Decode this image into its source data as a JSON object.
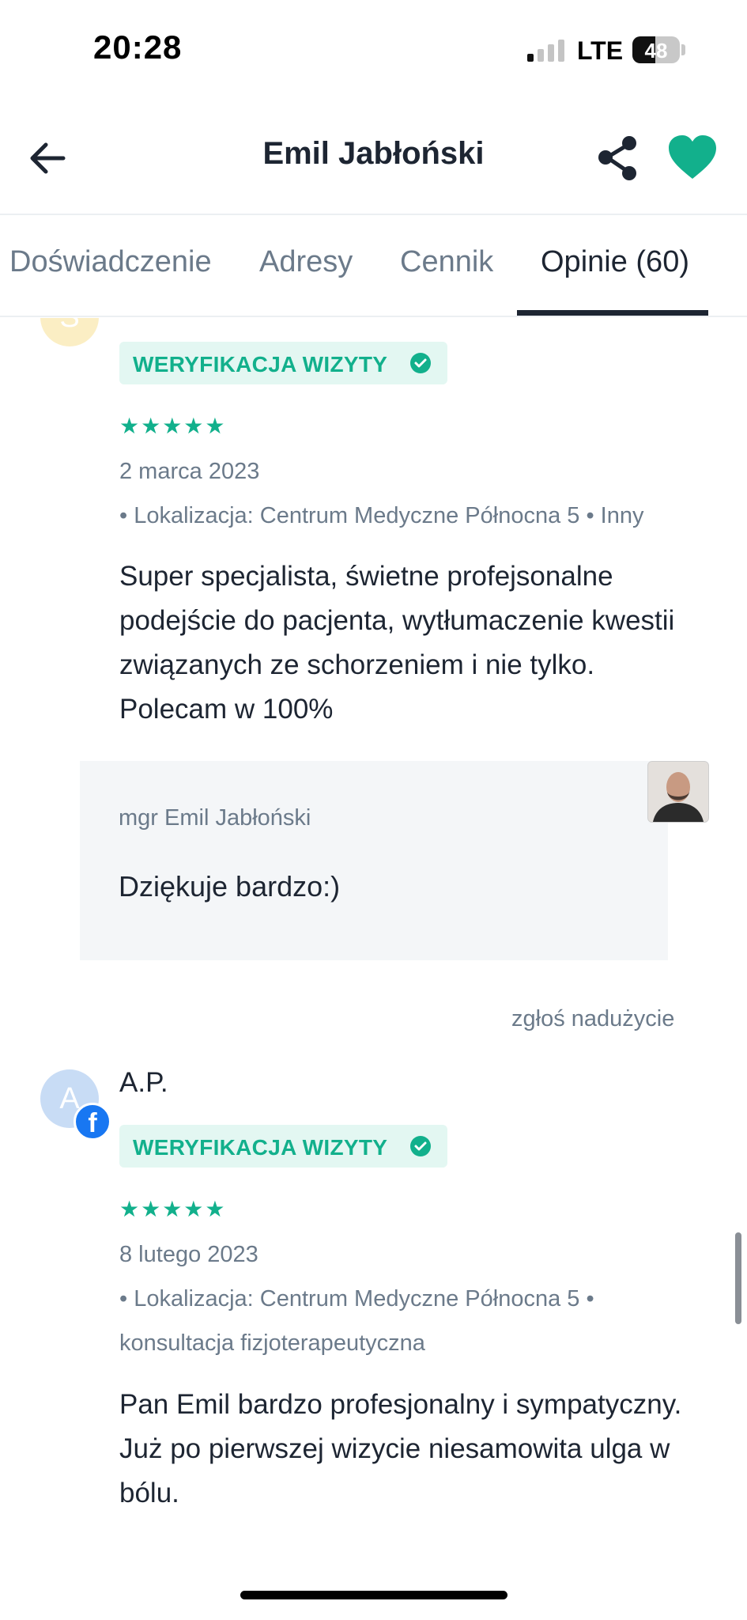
{
  "status_bar": {
    "time": "20:28",
    "network": "LTE",
    "battery": "48",
    "battery_level": 0.48
  },
  "header": {
    "title": "Emil Jabłoński"
  },
  "tabs": [
    {
      "label": "Doświadczenie",
      "active": false
    },
    {
      "label": "Adresy",
      "active": false
    },
    {
      "label": "Cennik",
      "active": false
    },
    {
      "label": "Opinie (60)",
      "active": true
    }
  ],
  "reviews": [
    {
      "avatar_initial": "S",
      "badge": "WERYFIKACJA WIZYTY",
      "rating": 5,
      "stars": "★★★★★",
      "date": "2 marca 2023",
      "meta": "• Lokalizacja: Centrum Medyczne Północna 5 • Inny",
      "text": "Super specjalista, świetne profejsonalne podejście do pacjenta, wytłumaczenie kwestii związanych ze schorzeniem i nie tylko. Polecam w 100%",
      "reply": {
        "author": "mgr Emil Jabłoński",
        "text": "Dziękuje bardzo:)"
      },
      "report_label": "zgłoś nadużycie"
    },
    {
      "avatar_initial": "A",
      "author": "A.P.",
      "source_icon": "facebook-icon",
      "badge": "WERYFIKACJA WIZYTY",
      "rating": 5,
      "stars": "★★★★★",
      "date": "8 lutego 2023",
      "meta": "• Lokalizacja: Centrum Medyczne Północna 5 • konsultacja fizjoterapeutyczna",
      "text": "Pan Emil bardzo profesjonalny i sympatyczny.\nJuż po pierwszej wizycie niesamowita ulga w bólu."
    }
  ],
  "colors": {
    "accent": "#12b08c",
    "text": "#1d2532",
    "muted": "#6b7a8a",
    "heart": "#12b08c"
  }
}
